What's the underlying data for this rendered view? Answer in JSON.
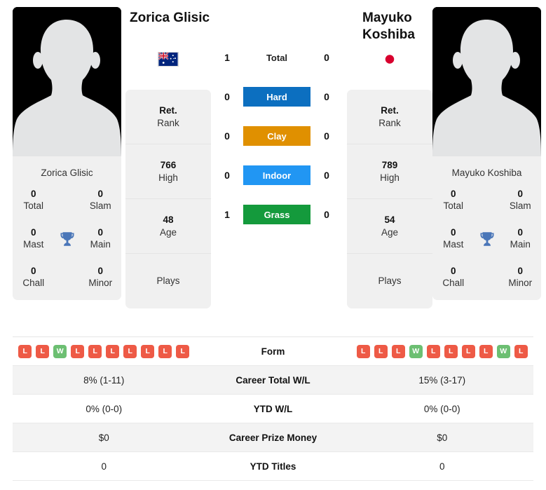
{
  "players": {
    "left": {
      "name": "Zorica Glisic",
      "card_name": "Zorica Glisic",
      "flag": "australia-flag",
      "avatar": "player-avatar-placeholder",
      "rank": {
        "value": "Ret.",
        "label": "Rank"
      },
      "high": {
        "value": "766",
        "label": "High"
      },
      "age": {
        "value": "48",
        "label": "Age"
      },
      "plays": {
        "value": "",
        "label": "Plays"
      },
      "titles": [
        {
          "num": "0",
          "label": "Total"
        },
        {
          "num": "0",
          "label": "Slam"
        },
        {
          "num": "0",
          "label": "Mast"
        },
        {
          "num": "0",
          "label": "Main"
        },
        {
          "num": "0",
          "label": "Chall"
        },
        {
          "num": "0",
          "label": "Minor"
        }
      ],
      "form": [
        "L",
        "L",
        "W",
        "L",
        "L",
        "L",
        "L",
        "L",
        "L",
        "L"
      ]
    },
    "right": {
      "name": "Mayuko Koshiba",
      "card_name": "Mayuko Koshiba",
      "flag": "japan-flag",
      "avatar": "player-avatar-placeholder",
      "rank": {
        "value": "Ret.",
        "label": "Rank"
      },
      "high": {
        "value": "789",
        "label": "High"
      },
      "age": {
        "value": "54",
        "label": "Age"
      },
      "plays": {
        "value": "",
        "label": "Plays"
      },
      "titles": [
        {
          "num": "0",
          "label": "Total"
        },
        {
          "num": "0",
          "label": "Slam"
        },
        {
          "num": "0",
          "label": "Mast"
        },
        {
          "num": "0",
          "label": "Main"
        },
        {
          "num": "0",
          "label": "Chall"
        },
        {
          "num": "0",
          "label": "Minor"
        }
      ],
      "form": [
        "L",
        "L",
        "L",
        "W",
        "L",
        "L",
        "L",
        "L",
        "W",
        "L"
      ]
    }
  },
  "head_to_head": [
    {
      "label": "Total",
      "left": "1",
      "right": "0",
      "color": "",
      "text_color": "#222222"
    },
    {
      "label": "Hard",
      "left": "0",
      "right": "0",
      "color": "#0c6fc0",
      "text_color": "#ffffff"
    },
    {
      "label": "Clay",
      "left": "0",
      "right": "0",
      "color": "#e09000",
      "text_color": "#ffffff"
    },
    {
      "label": "Indoor",
      "left": "0",
      "right": "0",
      "color": "#2196f3",
      "text_color": "#ffffff"
    },
    {
      "label": "Grass",
      "left": "1",
      "right": "0",
      "color": "#149a3c",
      "text_color": "#ffffff"
    }
  ],
  "stats_rows": [
    {
      "label": "Form",
      "left": "",
      "right": "",
      "type": "form"
    },
    {
      "label": "Career Total W/L",
      "left": "8% (1-11)",
      "right": "15% (3-17)",
      "type": "text"
    },
    {
      "label": "YTD W/L",
      "left": "0% (0-0)",
      "right": "0% (0-0)",
      "type": "text"
    },
    {
      "label": "Career Prize Money",
      "left": "$0",
      "right": "$0",
      "type": "text"
    },
    {
      "label": "YTD Titles",
      "left": "0",
      "right": "0",
      "type": "text"
    }
  ],
  "colors": {
    "win": "#6cbf72",
    "loss": "#ee5a46",
    "card_bg": "#f0f0f0",
    "row_alt": "#f3f3f3",
    "trophy": "#4a76b8",
    "jp_red": "#d8002e",
    "au_navy": "#00247d"
  },
  "icons": {
    "trophy": "trophy-icon"
  }
}
